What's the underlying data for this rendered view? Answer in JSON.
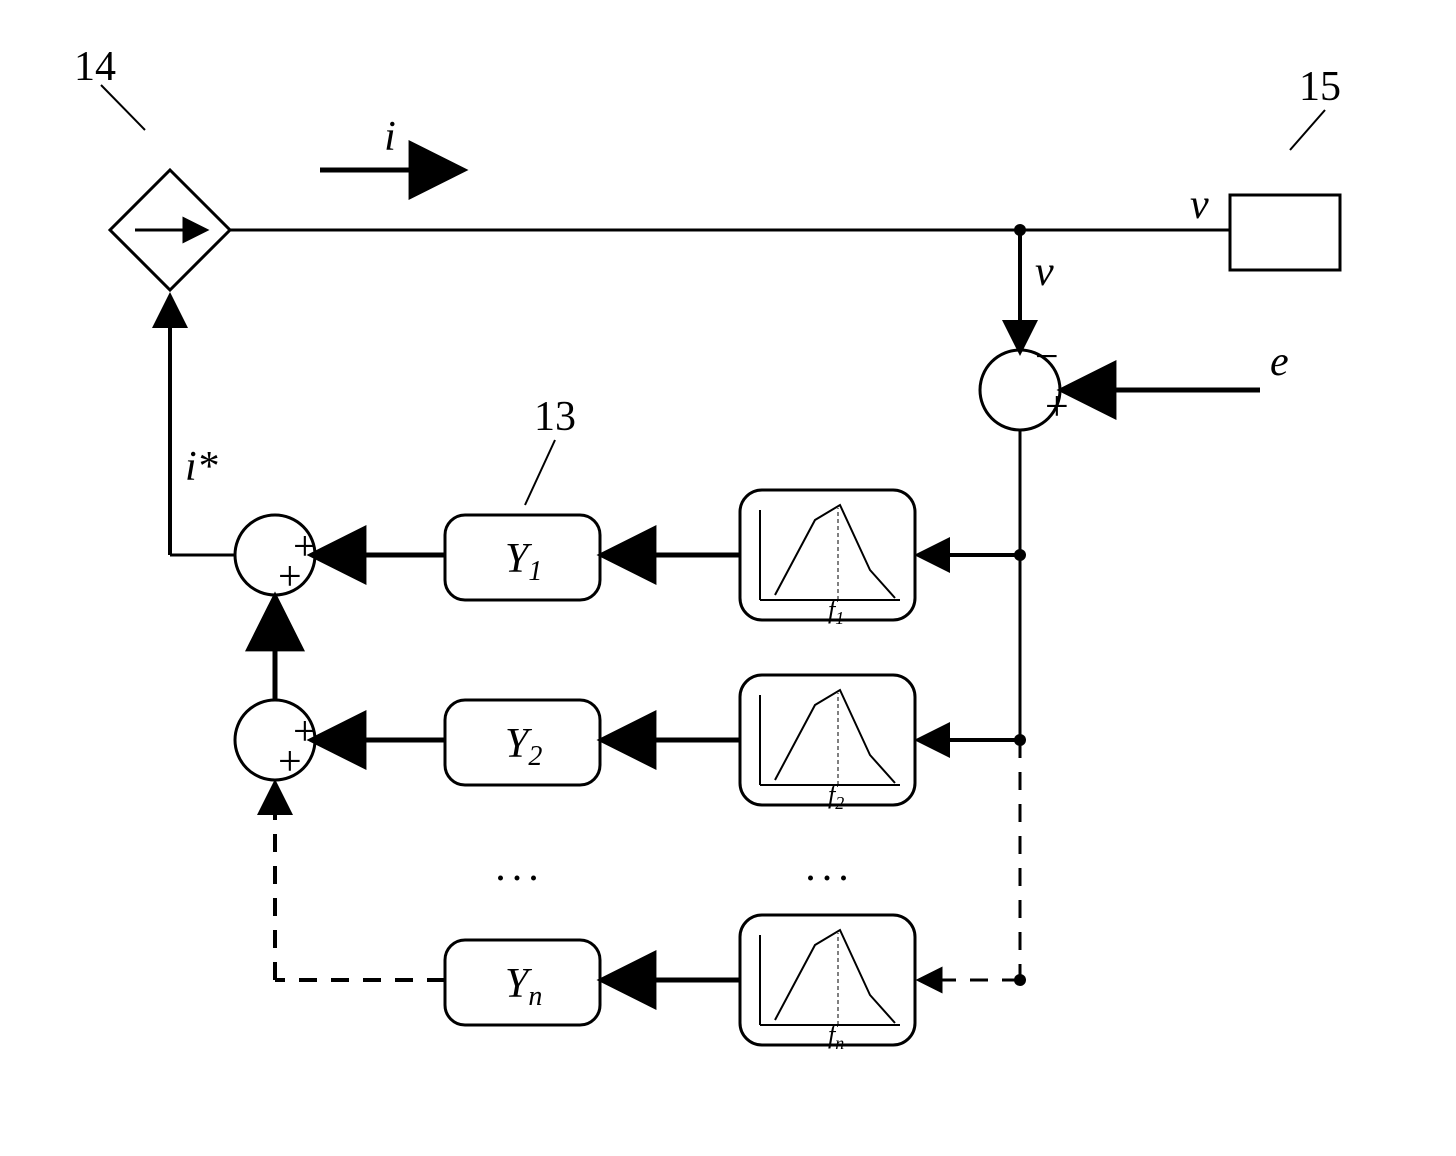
{
  "labels": {
    "ref14": "14",
    "ref15": "15",
    "ref13": "13",
    "i_arrow": "i",
    "v_right": "v",
    "v_tap": "v",
    "e": "e",
    "i_star": "i*",
    "minus": "−",
    "plus": "+",
    "Y1": "Y",
    "Y1_sub": "1",
    "Y2": "Y",
    "Y2_sub": "2",
    "Yn": "Y",
    "Yn_sub": "n",
    "f1": "f",
    "f1_sub": "1",
    "f2": "f",
    "f2_sub": "2",
    "fn": "f",
    "fn_sub": "n",
    "plus_sum": "+",
    "ell": "..."
  },
  "chart_data": {
    "type": "block-diagram",
    "description": "Control block diagram with current source (14) feeding a load (15). Voltage v is tapped, subtracted from reference e. Error passes through n parallel band-pass filters at center frequencies f1..fn, each followed by admittance gain Y1..Yn. Outputs are summed to produce current reference i* which drives the controlled current source.",
    "blocks": [
      {
        "id": 14,
        "type": "controlled-current-source"
      },
      {
        "id": 15,
        "type": "load"
      },
      {
        "id": 13,
        "type": "gain",
        "value": "Y1"
      }
    ],
    "filters": [
      "f1",
      "f2",
      "fn"
    ],
    "gains": [
      "Y1",
      "Y2",
      "Yn"
    ],
    "signals": [
      "i",
      "v",
      "e",
      "i*"
    ],
    "summing_junctions": [
      {
        "inputs": [
          "e(+)",
          "v(-)"
        ],
        "output": "error"
      },
      {
        "inputs": [
          "Y1 out(+)",
          "sum2(+)"
        ],
        "output": "i*"
      },
      {
        "inputs": [
          "Y2 out(+)",
          "Yn out(+, dashed)"
        ],
        "output": "sum2"
      }
    ]
  }
}
